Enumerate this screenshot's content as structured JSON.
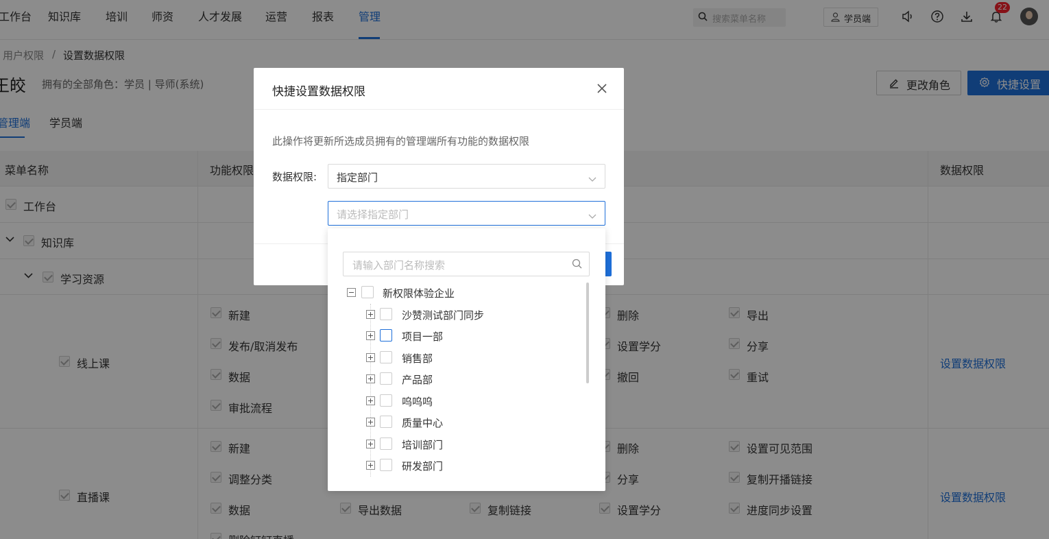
{
  "nav": {
    "items": [
      "工作台",
      "知识库",
      "培训",
      "师资",
      "人才发展",
      "运营",
      "报表",
      "管理"
    ],
    "active": "管理",
    "search_placeholder": "搜索菜单名称",
    "student_btn": "学员端",
    "badge_count": "22"
  },
  "breadcrumb": {
    "parent": "用户权限",
    "sep": "/",
    "current": "设置数据权限"
  },
  "user": {
    "name": "王皎",
    "roles": "拥有的全部角色：学员 | 导师(系统)"
  },
  "actions": {
    "change_role": "更改角色",
    "quick_set": "快捷设置"
  },
  "tabs": [
    "管理端",
    "学员端"
  ],
  "table": {
    "headers": {
      "menu": "菜单名称",
      "func": "功能权限",
      "data": "数据权限"
    },
    "rows": {
      "workbench": "工作台",
      "knowledge": "知识库",
      "learning": "学习资源",
      "online": "线上课",
      "live": "直播课"
    },
    "online_perms": [
      "新建",
      "删除",
      "导出",
      "发布/取消发布",
      "设置学分",
      "分享",
      "数据",
      "撤回",
      "重试",
      "审批流程"
    ],
    "live_perms": [
      "新建",
      "删除",
      "设置可见范围",
      "调整分类",
      "分享",
      "复制开播链接",
      "数据",
      "导出数据",
      "复制链接",
      "设置学分",
      "进度同步设置",
      "删除钉钉直播"
    ],
    "set_link": "设置数据权限"
  },
  "modal": {
    "title": "快捷设置数据权限",
    "desc": "此操作将更新所选成员拥有的管理端所有功能的数据权限",
    "label": "数据权限:",
    "scope_value": "指定部门",
    "dept_placeholder": "请选择指定部门"
  },
  "dropdown": {
    "search_placeholder": "请输入部门名称搜索",
    "root": "新权限体验企业",
    "children": [
      "沙赞测试部门同步",
      "项目一部",
      "销售部",
      "产品部",
      "呜呜呜",
      "质量中心",
      "培训部门",
      "研发部门"
    ]
  },
  "colors": {
    "accent": "#1e6fd9",
    "badge": "#f5222d"
  }
}
